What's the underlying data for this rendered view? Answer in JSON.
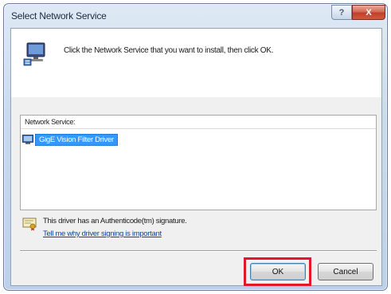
{
  "window": {
    "title": "Select Network Service",
    "help_glyph": "?",
    "close_glyph": "X"
  },
  "header": {
    "instruction": "Click the Network Service that you want to install, then click OK.",
    "icon": "network-computer-icon"
  },
  "list": {
    "header": "Network Service:",
    "items": [
      {
        "label": "GigE Vision Filter Driver",
        "selected": true,
        "icon": "network-service-icon"
      }
    ]
  },
  "signature": {
    "text": "This driver has an Authenticode(tm) signature.",
    "link": "Tell me why driver signing is important",
    "icon": "certificate-icon"
  },
  "buttons": {
    "ok": "OK",
    "cancel": "Cancel"
  },
  "colors": {
    "selection": "#3399ff",
    "highlight_box": "#e0182a",
    "link": "#0645ad"
  }
}
